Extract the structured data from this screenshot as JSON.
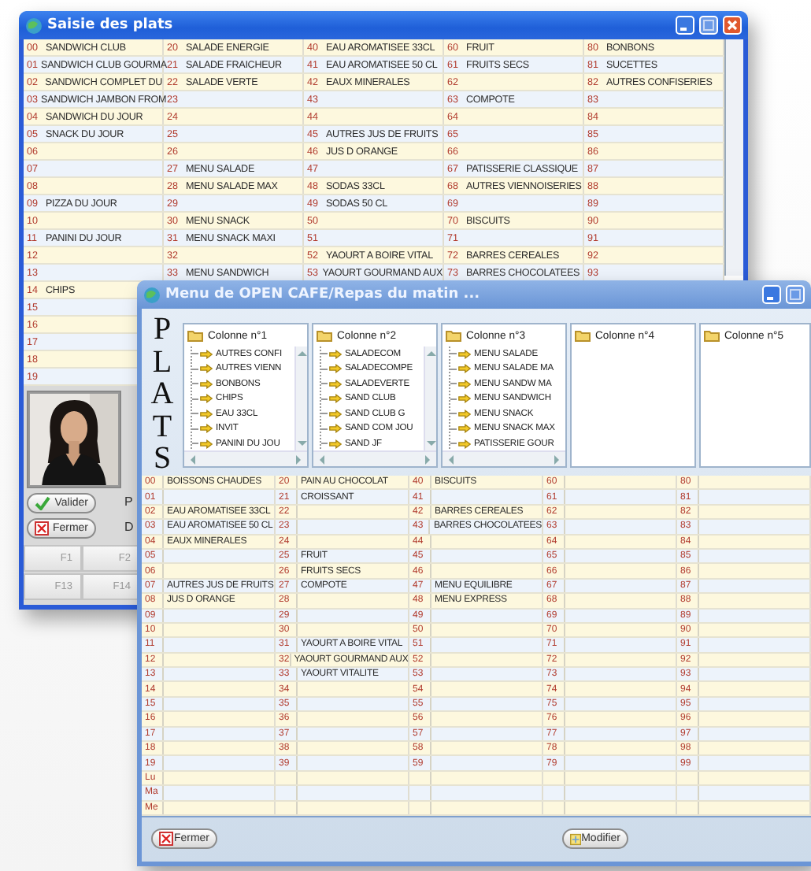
{
  "main_window": {
    "title": "Saisie des plats",
    "grid": {
      "columns": [
        {
          "cells": [
            {
              "number": "00",
              "label": "SANDWICH CLUB"
            },
            {
              "number": "01",
              "label": "SANDWICH CLUB GOURMA"
            },
            {
              "number": "02",
              "label": "SANDWICH COMPLET DU"
            },
            {
              "number": "03",
              "label": "SANDWICH JAMBON FROM"
            },
            {
              "number": "04",
              "label": "SANDWICH DU JOUR"
            },
            {
              "number": "05",
              "label": "SNACK DU JOUR"
            },
            {
              "number": "06"
            },
            {
              "number": "07"
            },
            {
              "number": "08"
            },
            {
              "number": "09",
              "label": "PIZZA DU JOUR"
            },
            {
              "number": "10"
            },
            {
              "number": "11",
              "label": "PANINI DU JOUR"
            },
            {
              "number": "12"
            },
            {
              "number": "13"
            },
            {
              "number": "14",
              "label": "CHIPS"
            },
            {
              "number": "15"
            },
            {
              "number": "16"
            },
            {
              "number": "17"
            },
            {
              "number": "18"
            },
            {
              "number": "19"
            }
          ]
        },
        {
          "cells": [
            {
              "number": "20",
              "label": "SALADE ENERGIE"
            },
            {
              "number": "21",
              "label": "SALADE FRAICHEUR"
            },
            {
              "number": "22",
              "label": "SALADE VERTE"
            },
            {
              "number": "23"
            },
            {
              "number": "24"
            },
            {
              "number": "25"
            },
            {
              "number": "26"
            },
            {
              "number": "27",
              "label": "MENU SALADE"
            },
            {
              "number": "28",
              "label": "MENU SALADE MAX"
            },
            {
              "number": "29"
            },
            {
              "number": "30",
              "label": "MENU SNACK"
            },
            {
              "number": "31",
              "label": "MENU SNACK MAXI"
            },
            {
              "number": "32"
            },
            {
              "number": "33",
              "label": "MENU SANDWICH"
            }
          ]
        },
        {
          "cells": [
            {
              "number": "40",
              "label": "EAU AROMATISEE 33CL"
            },
            {
              "number": "41",
              "label": "EAU AROMATISEE 50 CL"
            },
            {
              "number": "42",
              "label": "EAUX MINERALES"
            },
            {
              "number": "43"
            },
            {
              "number": "44"
            },
            {
              "number": "45",
              "label": "AUTRES JUS DE FRUITS"
            },
            {
              "number": "46",
              "label": "JUS D ORANGE"
            },
            {
              "number": "47"
            },
            {
              "number": "48",
              "label": "SODAS 33CL"
            },
            {
              "number": "49",
              "label": "SODAS 50 CL"
            },
            {
              "number": "50"
            },
            {
              "number": "51"
            },
            {
              "number": "52",
              "label": "YAOURT A BOIRE VITAL"
            },
            {
              "number": "53",
              "label": "YAOURT GOURMAND AUX"
            }
          ]
        },
        {
          "cells": [
            {
              "number": "60",
              "label": "FRUIT"
            },
            {
              "number": "61",
              "label": "FRUITS SECS"
            },
            {
              "number": "62"
            },
            {
              "number": "63",
              "label": "COMPOTE"
            },
            {
              "number": "64"
            },
            {
              "number": "65"
            },
            {
              "number": "66"
            },
            {
              "number": "67",
              "label": "PATISSERIE CLASSIQUE"
            },
            {
              "number": "68",
              "label": "AUTRES VIENNOISERIES"
            },
            {
              "number": "69"
            },
            {
              "number": "70",
              "label": "BISCUITS"
            },
            {
              "number": "71"
            },
            {
              "number": "72",
              "label": "BARRES CEREALES"
            },
            {
              "number": "73",
              "label": "BARRES CHOCOLATEES"
            }
          ]
        },
        {
          "cells": [
            {
              "number": "80",
              "label": "BONBONS"
            },
            {
              "number": "81",
              "label": "SUCETTES"
            },
            {
              "number": "82",
              "label": "AUTRES CONFISERIES"
            },
            {
              "number": "83"
            },
            {
              "number": "84"
            },
            {
              "number": "85"
            },
            {
              "number": "86"
            },
            {
              "number": "87"
            },
            {
              "number": "88"
            },
            {
              "number": "89"
            },
            {
              "number": "90"
            },
            {
              "number": "91"
            },
            {
              "number": "92"
            },
            {
              "number": "93"
            }
          ]
        }
      ]
    },
    "photo": {
      "kind": "picture"
    },
    "buttons": [
      {
        "label": "Valider",
        "kind": "ok"
      },
      {
        "label": "Fermer",
        "kind": "cancel"
      }
    ],
    "side_letters": [
      "P",
      "D"
    ],
    "function_keys": [
      [
        "F1",
        "F2"
      ],
      [
        "F13",
        "F14"
      ]
    ]
  },
  "menu_window": {
    "title": "Menu de OPEN CAFE/Repas du matin ...",
    "side_title": [
      "P",
      "L",
      "A",
      "T",
      "S"
    ],
    "tree_columns": [
      {
        "header": "Colonne n°1",
        "vertical_scrollbar": true,
        "items": [
          "AUTRES CONFI",
          "AUTRES VIENN",
          "BONBONS",
          "CHIPS",
          "EAU 33CL",
          "INVIT",
          "PANINI DU JOU"
        ]
      },
      {
        "header": "Colonne n°2",
        "vertical_scrollbar": true,
        "items": [
          "SALADECOM",
          "SALADECOMPE",
          "SALADEVERTE",
          "SAND CLUB",
          "SAND CLUB G",
          "SAND COM JOU",
          "SAND JF"
        ]
      },
      {
        "header": "Colonne n°3",
        "vertical_scrollbar": false,
        "items": [
          "MENU SALADE",
          "MENU SALADE MA",
          "MENU SANDW MA",
          "MENU SANDWICH",
          "MENU SNACK",
          "MENU SNACK MAX",
          "PATISSERIE GOUR"
        ]
      },
      {
        "header": "Colonne n°4",
        "vertical_scrollbar": false
      },
      {
        "header": "Colonne n°5",
        "vertical_scrollbar": false
      }
    ],
    "grid": {
      "columns": [
        {
          "cells": [
            {
              "number": "00",
              "label": "BOISSONS CHAUDES"
            },
            {
              "number": "01"
            },
            {
              "number": "02",
              "label": "EAU AROMATISEE 33CL"
            },
            {
              "number": "03",
              "label": "EAU AROMATISEE 50 CL"
            },
            {
              "number": "04",
              "label": "EAUX MINERALES"
            },
            {
              "number": "05"
            },
            {
              "number": "06"
            },
            {
              "number": "07",
              "label": "AUTRES JUS DE FRUITS"
            },
            {
              "number": "08",
              "label": "JUS D ORANGE"
            },
            {
              "number": "09"
            },
            {
              "number": "10"
            },
            {
              "number": "11"
            },
            {
              "number": "12"
            },
            {
              "number": "13"
            },
            {
              "number": "14"
            },
            {
              "number": "15"
            },
            {
              "number": "16"
            },
            {
              "number": "17"
            },
            {
              "number": "18"
            },
            {
              "number": "19"
            }
          ]
        },
        {
          "cells": [
            {
              "number": "20",
              "label": "PAIN AU CHOCOLAT"
            },
            {
              "number": "21",
              "label": "CROISSANT"
            },
            {
              "number": "22"
            },
            {
              "number": "23"
            },
            {
              "number": "24"
            },
            {
              "number": "25",
              "label": "FRUIT"
            },
            {
              "number": "26",
              "label": "FRUITS SECS"
            },
            {
              "number": "27",
              "label": "COMPOTE"
            },
            {
              "number": "28"
            },
            {
              "number": "29"
            },
            {
              "number": "30"
            },
            {
              "number": "31",
              "label": "YAOURT A BOIRE VITAL"
            },
            {
              "number": "32",
              "label": "YAOURT GOURMAND AUX"
            },
            {
              "number": "33",
              "label": "YAOURT VITALITE"
            },
            {
              "number": "34"
            },
            {
              "number": "35"
            },
            {
              "number": "36"
            },
            {
              "number": "37"
            },
            {
              "number": "38"
            },
            {
              "number": "39"
            }
          ]
        },
        {
          "cells": [
            {
              "number": "40",
              "label": "BISCUITS"
            },
            {
              "number": "41"
            },
            {
              "number": "42",
              "label": "BARRES CEREALES"
            },
            {
              "number": "43",
              "label": "BARRES CHOCOLATEES"
            },
            {
              "number": "44"
            },
            {
              "number": "45"
            },
            {
              "number": "46"
            },
            {
              "number": "47",
              "label": "MENU EQUILIBRE"
            },
            {
              "number": "48",
              "label": "MENU EXPRESS"
            },
            {
              "number": "49"
            },
            {
              "number": "50"
            },
            {
              "number": "51"
            },
            {
              "number": "52"
            },
            {
              "number": "53"
            },
            {
              "number": "54"
            },
            {
              "number": "55"
            },
            {
              "number": "56"
            },
            {
              "number": "57"
            },
            {
              "number": "58"
            },
            {
              "number": "59"
            }
          ]
        },
        {
          "cells": [
            {
              "number": "60"
            },
            {
              "number": "61"
            },
            {
              "number": "62"
            },
            {
              "number": "63"
            },
            {
              "number": "64"
            },
            {
              "number": "65"
            },
            {
              "number": "66"
            },
            {
              "number": "67"
            },
            {
              "number": "68"
            },
            {
              "number": "69"
            },
            {
              "number": "70"
            },
            {
              "number": "71"
            },
            {
              "number": "72"
            },
            {
              "number": "73"
            },
            {
              "number": "74"
            },
            {
              "number": "75"
            },
            {
              "number": "76"
            },
            {
              "number": "77"
            },
            {
              "number": "78"
            },
            {
              "number": "79"
            }
          ]
        },
        {
          "cells": [
            {
              "number": "80"
            },
            {
              "number": "81"
            },
            {
              "number": "82"
            },
            {
              "number": "83"
            },
            {
              "number": "84"
            },
            {
              "number": "85"
            },
            {
              "number": "86"
            },
            {
              "number": "87"
            },
            {
              "number": "88"
            },
            {
              "number": "89"
            },
            {
              "number": "90"
            },
            {
              "number": "91"
            },
            {
              "number": "92"
            },
            {
              "number": "93"
            },
            {
              "number": "94"
            },
            {
              "number": "95"
            },
            {
              "number": "96"
            },
            {
              "number": "97"
            },
            {
              "number": "98"
            },
            {
              "number": "99"
            }
          ]
        }
      ],
      "day_rows": [
        "Lu",
        "Ma",
        "Me"
      ]
    },
    "buttons": [
      {
        "label": "Fermer",
        "kind": "cancel"
      },
      {
        "label": "Modifier",
        "kind": "edit"
      }
    ]
  }
}
